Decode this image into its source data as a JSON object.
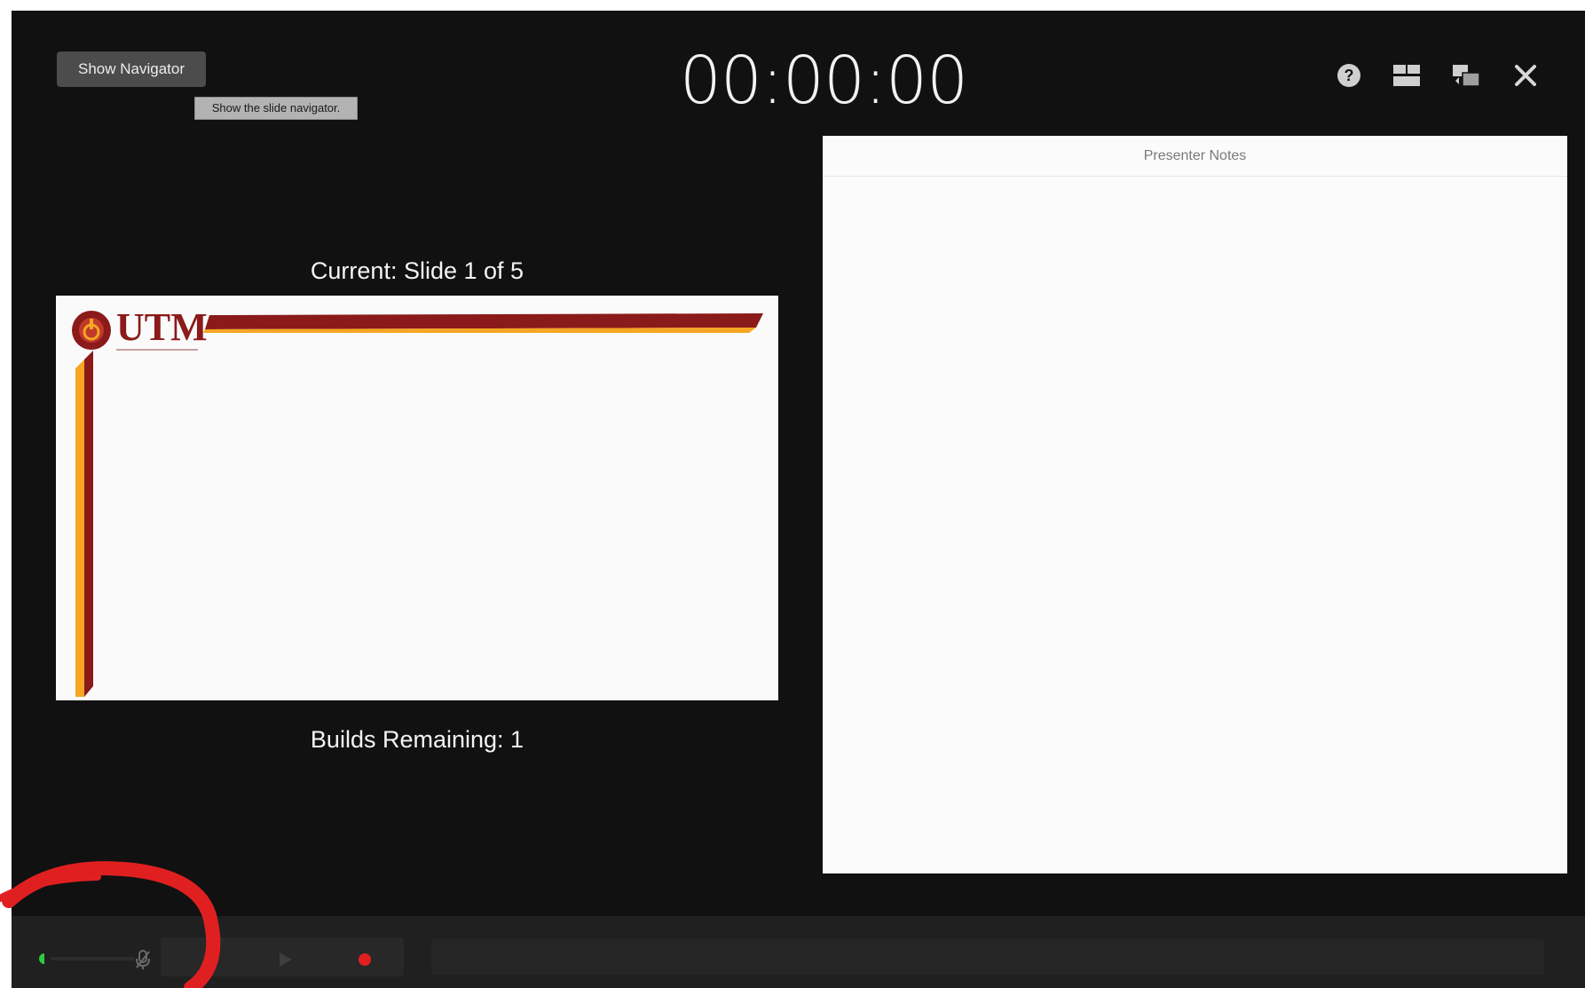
{
  "toolbar": {
    "show_navigator_label": "Show Navigator",
    "tooltip": "Show the slide navigator.",
    "timer": "00:00:00",
    "icons": [
      "help-icon",
      "layout-icon",
      "swap-displays-icon",
      "close-icon"
    ]
  },
  "current_slide": {
    "label": "Current: Slide 1 of 5",
    "logo_text": "UTM"
  },
  "builds": {
    "label": "Builds Remaining: 1"
  },
  "notes": {
    "header": "Presenter Notes"
  },
  "recording": {
    "icons": [
      "mic-level-icon",
      "mic-muted-icon",
      "play-icon",
      "record-icon"
    ]
  },
  "colors": {
    "background": "#111111",
    "accent_red": "#e02020",
    "brand_maroon": "#8b1a1a",
    "brand_gold": "#f5a623"
  }
}
